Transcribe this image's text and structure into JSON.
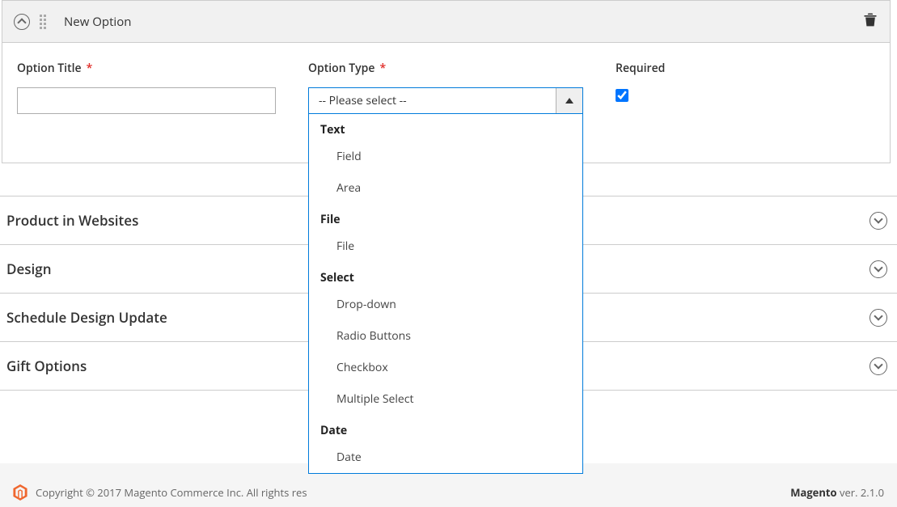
{
  "option": {
    "header_title": "New Option",
    "title_label": "Option Title",
    "title_value": "",
    "type_label": "Option Type",
    "type_placeholder": "-- Please select --",
    "required_label": "Required",
    "required_checked": true,
    "dropdown": {
      "groups": [
        {
          "label": "Text",
          "items": [
            "Field",
            "Area"
          ]
        },
        {
          "label": "File",
          "items": [
            "File"
          ]
        },
        {
          "label": "Select",
          "items": [
            "Drop-down",
            "Radio Buttons",
            "Checkbox",
            "Multiple Select"
          ]
        },
        {
          "label": "Date",
          "items": [
            "Date"
          ]
        }
      ]
    }
  },
  "sections": [
    "Product in Websites",
    "Design",
    "Schedule Design Update",
    "Gift Options"
  ],
  "footer": {
    "copyright": "Copyright © 2017 Magento Commerce Inc. All rights res",
    "brand": "Magento",
    "ver_label": " ver. 2.1.0"
  }
}
